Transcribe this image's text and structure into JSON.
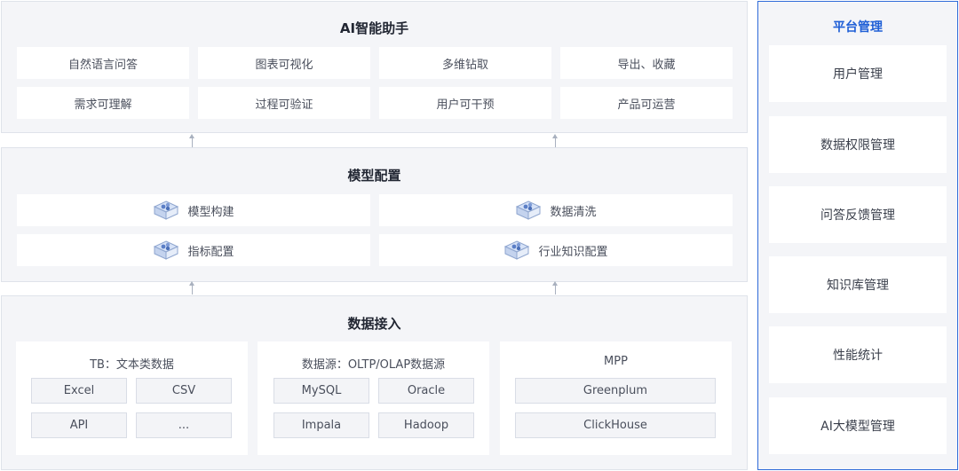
{
  "ai": {
    "title": "AI智能助手",
    "row1": [
      "自然语言问答",
      "图表可视化",
      "多维钻取",
      "导出、收藏"
    ],
    "row2": [
      "需求可理解",
      "过程可验证",
      "用户可干预",
      "产品可运营"
    ]
  },
  "model": {
    "title": "模型配置",
    "items": [
      "模型构建",
      "数据清洗",
      "指标配置",
      "行业知识配置"
    ]
  },
  "ingest": {
    "title": "数据接入",
    "groups": [
      {
        "title": "TB：文本类数据",
        "tags": [
          "Excel",
          "CSV",
          "API",
          "..."
        ]
      },
      {
        "title": "数据源：OLTP/OLAP数据源",
        "tags": [
          "MySQL",
          "Oracle",
          "Impala",
          "Hadoop"
        ]
      },
      {
        "title": "MPP",
        "tags": [
          "Greenplum",
          "ClickHouse"
        ]
      }
    ]
  },
  "platform": {
    "title": "平台管理",
    "items": [
      "用户管理",
      "数据权限管理",
      "问答反馈管理",
      "知识库管理",
      "性能统计",
      "AI大模型管理"
    ]
  },
  "colors": {
    "accent": "#1f5fd6",
    "panel": "#f4f5f8",
    "border": "#dfe3ea"
  },
  "icons": {
    "model_item": "cube-stack-icon",
    "arrow": "arrow-up-icon"
  }
}
